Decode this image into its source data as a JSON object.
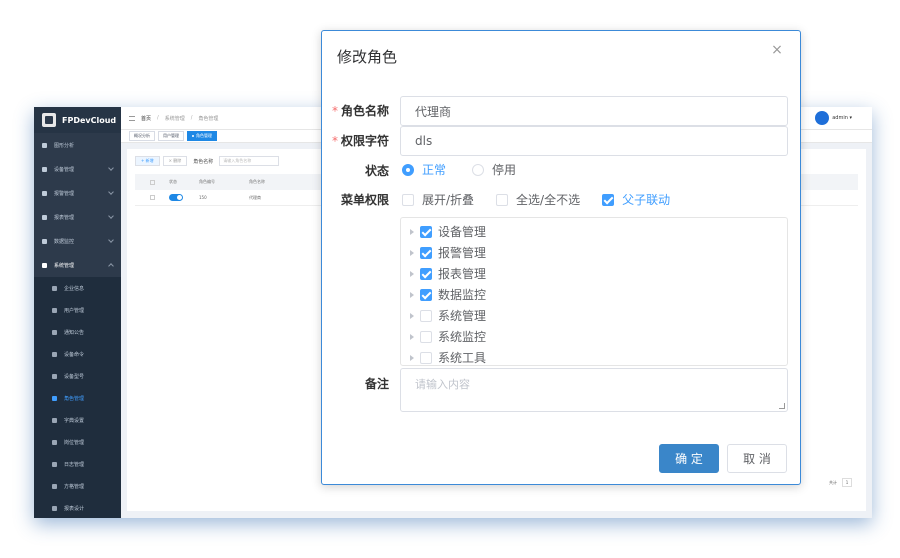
{
  "app": {
    "logo_text": "FPDevCloud",
    "user_name": "admin ▾"
  },
  "sidebar": {
    "items": [
      {
        "label": "图形分析"
      },
      {
        "label": "设备管理"
      },
      {
        "label": "报警管理"
      },
      {
        "label": "报表管理"
      },
      {
        "label": "数据监控"
      },
      {
        "label": "系统管理"
      }
    ],
    "sub_items": [
      {
        "label": "企业信息"
      },
      {
        "label": "用户管理"
      },
      {
        "label": "通知公告"
      },
      {
        "label": "设备命令"
      },
      {
        "label": "设备型号"
      },
      {
        "label": "角色管理"
      },
      {
        "label": "字典设置"
      },
      {
        "label": "岗位管理"
      },
      {
        "label": "日志管理"
      },
      {
        "label": "方格管理"
      },
      {
        "label": "报表设计"
      }
    ]
  },
  "breadcrumb": {
    "home": "首页",
    "section": "系统管理",
    "page": "角色管理"
  },
  "tags": [
    "概况分析",
    "用户管理",
    "角色管理"
  ],
  "list_toolbar": {
    "add": "+ 新增",
    "delete": "× 删除",
    "search_label": "角色名称",
    "search_placeholder": "请输入角色名称"
  },
  "table": {
    "headers": [
      "状态",
      "角色编号",
      "角色名称"
    ],
    "rows": [
      {
        "no": "150",
        "name": "代理商"
      }
    ]
  },
  "pager": {
    "total": "共计",
    "page": "1"
  },
  "modal": {
    "title": "修改角色",
    "close": "×",
    "fields": {
      "role_name_label": "角色名称",
      "role_name_value": "代理商",
      "perm_char_label": "权限字符",
      "perm_char_value": "dls",
      "status_label": "状态",
      "status_options": [
        "正常",
        "停用"
      ],
      "status_selected": "正常",
      "menu_perm_label": "菜单权限",
      "menu_options": {
        "expand": "展开/折叠",
        "select_all": "全选/全不选",
        "linkage": "父子联动"
      },
      "remark_label": "备注",
      "remark_placeholder": "请输入内容"
    },
    "tree": [
      {
        "label": "设备管理",
        "checked": true
      },
      {
        "label": "报警管理",
        "checked": true
      },
      {
        "label": "报表管理",
        "checked": true
      },
      {
        "label": "数据监控",
        "checked": true
      },
      {
        "label": "系统管理",
        "checked": false
      },
      {
        "label": "系统监控",
        "checked": false
      },
      {
        "label": "系统工具",
        "checked": false
      }
    ],
    "buttons": {
      "confirm": "确 定",
      "cancel": "取 消"
    }
  },
  "colors": {
    "primary": "#409eff",
    "confirm_button": "#3a86c9",
    "sidebar": "#2d3a4b",
    "required": "#f56c6c"
  }
}
